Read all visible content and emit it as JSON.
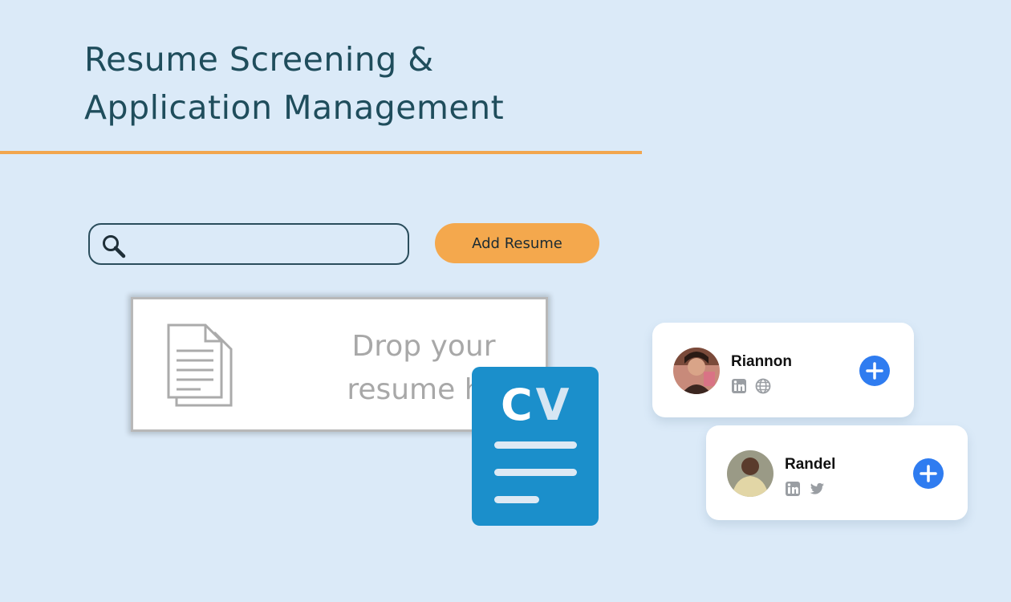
{
  "header": {
    "title_line1": "Resume Screening &",
    "title_line2": "Application Management"
  },
  "search": {
    "placeholder": "",
    "icon": "search-icon"
  },
  "add_resume_button": {
    "label": "Add Resume"
  },
  "dropzone": {
    "line1": "Drop your",
    "line2": "resume he",
    "icon": "document-icon"
  },
  "cv_badge": {
    "letters": "CV",
    "first": "C",
    "second": "V"
  },
  "candidates": [
    {
      "name": "Riannon",
      "socials": [
        "linkedin-icon",
        "globe-icon"
      ],
      "action_icon": "plus-icon"
    },
    {
      "name": "Randel",
      "socials": [
        "linkedin-icon",
        "twitter-icon"
      ],
      "action_icon": "plus-icon"
    }
  ],
  "colors": {
    "background": "#dbeaf8",
    "title": "#1f4d5c",
    "accent_orange": "#f4a84d",
    "cv_blue": "#1b8fcb",
    "action_blue": "#2f7cf0"
  }
}
